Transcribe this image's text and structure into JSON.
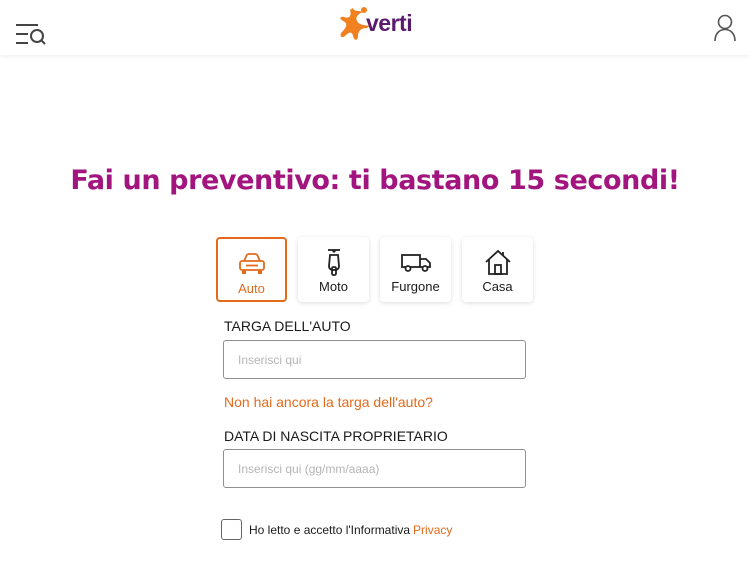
{
  "header": {
    "menu_icon": "menu-search-icon",
    "logo_text": "verti",
    "user_icon": "user-icon"
  },
  "hero": {
    "title": "Fai un preventivo: ti bastano 15 secondi!"
  },
  "colors": {
    "accent": "#e36a1b",
    "title": "#a3157e",
    "brand": "#5a1a6e"
  },
  "tiles": [
    {
      "label": "Auto",
      "icon": "car-icon",
      "selected": true
    },
    {
      "label": "Moto",
      "icon": "scooter-icon",
      "selected": false
    },
    {
      "label": "Furgone",
      "icon": "van-icon",
      "selected": false
    },
    {
      "label": "Casa",
      "icon": "house-icon",
      "selected": false
    }
  ],
  "form": {
    "plate_label": "TARGA DELL'AUTO",
    "plate_placeholder": "Inserisci qui",
    "no_plate_link": "Non hai ancora la targa dell'auto?",
    "birth_label": "DATA DI NASCITA PROPRIETARIO",
    "birth_placeholder": "Inserisci qui (gg/mm/aaaa)",
    "consent_text": "Ho letto e accetto l'Informativa",
    "privacy_link": "Privacy"
  }
}
